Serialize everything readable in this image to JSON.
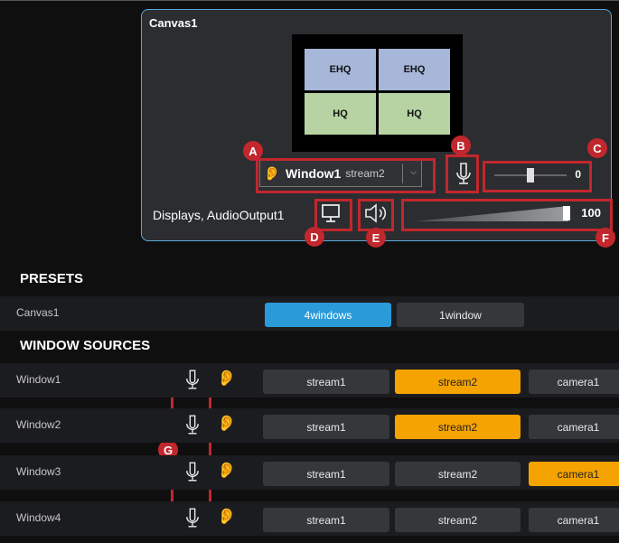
{
  "canvas": {
    "title": "Canvas1",
    "layout_cells": [
      "EHQ",
      "EHQ",
      "HQ",
      "HQ"
    ],
    "window_select": {
      "window": "Window1",
      "stream": "stream2"
    },
    "gain_value": "0",
    "outputs_label": "Displays, AudioOutput1",
    "volume_value": "100",
    "gain_level": 0.5,
    "volume_level": 1.0
  },
  "annotations": {
    "a": "A",
    "b": "B",
    "c": "C",
    "d": "D",
    "e": "E",
    "f": "F",
    "g": "G"
  },
  "presets": {
    "title": "PRESETS",
    "row_label": "Canvas1",
    "buttons": [
      "4windows",
      "1window"
    ],
    "active": "4windows"
  },
  "window_sources": {
    "title": "WINDOW SOURCES",
    "rows": [
      {
        "label": "Window1",
        "streams": [
          "stream1",
          "stream2",
          "camera1"
        ],
        "active": "stream2",
        "ear_active": true
      },
      {
        "label": "Window2",
        "streams": [
          "stream1",
          "stream2",
          "camera1"
        ],
        "active": "stream2",
        "ear_active": false
      },
      {
        "label": "Window3",
        "streams": [
          "stream1",
          "stream2",
          "camera1"
        ],
        "active": "camera1",
        "ear_active": false
      },
      {
        "label": "Window4",
        "streams": [
          "stream1",
          "stream2",
          "camera1"
        ],
        "active": "",
        "ear_active": false
      }
    ]
  },
  "colors": {
    "accent_blue": "#2b9ad8",
    "active_orange": "#f5a300",
    "annotation_red": "#c1272d",
    "card_border": "#5aa9d8"
  }
}
